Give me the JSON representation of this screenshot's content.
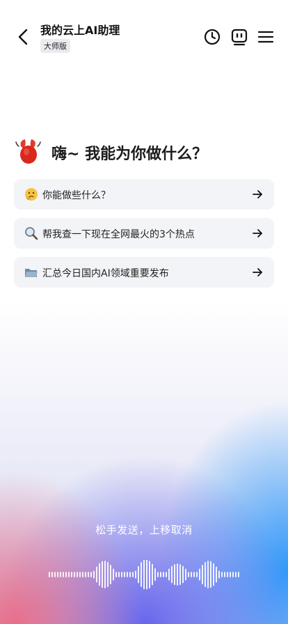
{
  "header": {
    "title": "我的云上AI助理",
    "badge": "大师版",
    "icons": [
      "back-arrow-icon",
      "history-clock-icon",
      "robot-icon",
      "menu-icon"
    ]
  },
  "greeting": {
    "icon": "lobster-claw-icon",
    "text": "嗨~ 我能为你做什么？"
  },
  "suggestions": [
    {
      "icon": "thinking-face-icon",
      "label": "你能做些什么？"
    },
    {
      "icon": "magnifier-icon",
      "label": "帮我查一下现在全网最火的3个热点"
    },
    {
      "icon": "folder-icon",
      "label": "汇总今日国内AI领域重要发布"
    }
  ],
  "voice": {
    "hint": "松手发送，上移取消",
    "icon": "waveform-icon"
  },
  "colors": {
    "text": "#111111",
    "card_bg": "#f3f4f7",
    "gradient_pink": "#ec6882",
    "gradient_purple": "#6260ec",
    "gradient_blue": "#2896fa"
  }
}
